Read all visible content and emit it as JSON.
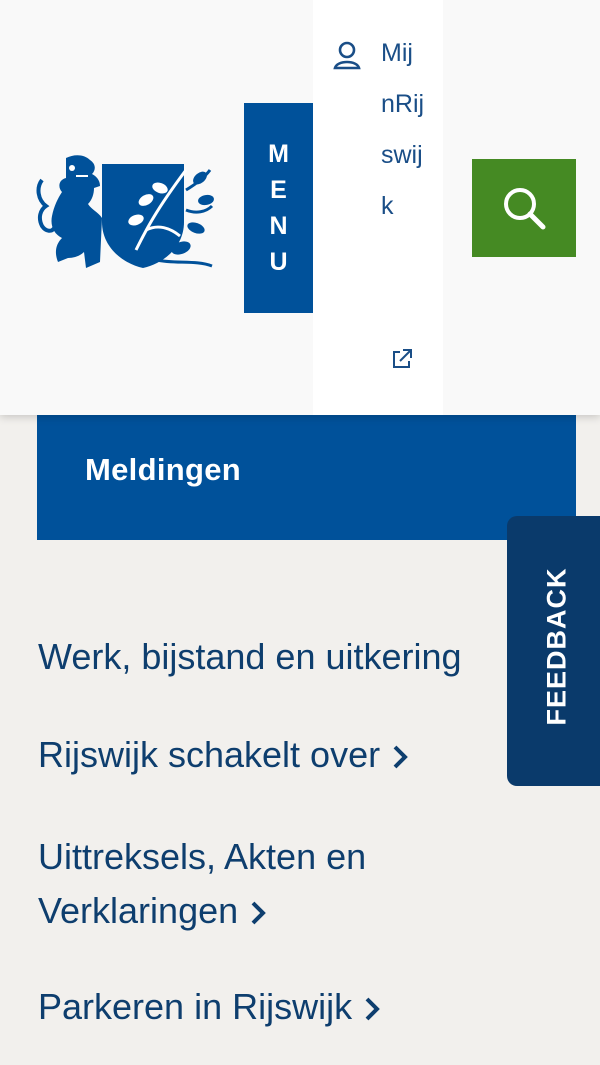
{
  "header": {
    "menu_letters": [
      "M",
      "E",
      "N",
      "U"
    ],
    "account_label": "MijnRijswijk",
    "icons": {
      "user": "user-icon",
      "external": "external-link-icon",
      "search": "search-icon",
      "logo": "rijswijk-logo"
    },
    "colors": {
      "primary": "#00519a",
      "search": "#458a23"
    }
  },
  "main": {
    "meldingen_label": "Meldingen",
    "links": [
      {
        "label": "Werk, bijstand en uitkering"
      },
      {
        "label": "Rijswijk schakelt over"
      },
      {
        "label_line1": "Uittreksels, Akten en",
        "label_line2": "Verklaringen"
      },
      {
        "label": "Parkeren in Rijswijk"
      }
    ]
  },
  "feedback": {
    "label": "FEEDBACK",
    "color": "#0a3a6b"
  }
}
